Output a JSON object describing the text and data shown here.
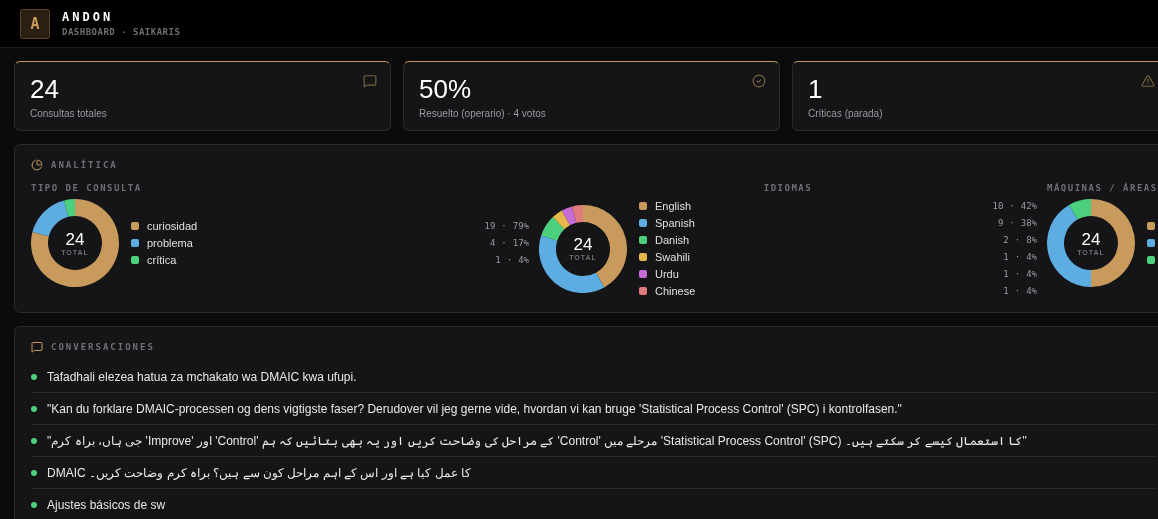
{
  "header": {
    "logo": "A",
    "title": "ANDON",
    "subtitle": "DASHBOARD · SAIKARIS"
  },
  "stats": [
    {
      "kind": "messages",
      "value": "24",
      "label": "Consultas totales"
    },
    {
      "kind": "resolved",
      "value": "50%",
      "label": "Resuelto (operario) · 4 votos"
    },
    {
      "kind": "alert",
      "value": "1",
      "label": "Críticas (parada)"
    }
  ],
  "analytics": {
    "title": "ANALÍTICA",
    "sections": [
      {
        "title": "TIPO DE CONSULTA",
        "kind": "legend",
        "total": "24",
        "total_label": "TOTAL",
        "chart_data": {
          "type": "donut",
          "values": [
            79,
            17,
            4
          ]
        },
        "items": [
          {
            "label": "curiosidad",
            "color": "#c89b5c",
            "count": "19",
            "separator": "·",
            "percent": "79%"
          },
          {
            "label": "problema",
            "color": "#5dade2",
            "count": "4",
            "separator": "·",
            "percent": "17%"
          },
          {
            "label": "crítica",
            "color": "#4cd07d",
            "count": "1",
            "separator": "·",
            "percent": "4%"
          }
        ]
      },
      {
        "title": "IDIOMAS",
        "kind": "legend",
        "total": "24",
        "total_label": "TOTAL",
        "chart_data": {
          "type": "donut",
          "values": [
            42,
            38,
            8,
            4,
            4,
            4
          ]
        },
        "items": [
          {
            "label": "English",
            "color": "#c89b5c",
            "count": "10",
            "separator": "·",
            "percent": "42%"
          },
          {
            "label": "Spanish",
            "color": "#5dade2",
            "count": "9",
            "separator": "·",
            "percent": "38%"
          },
          {
            "label": "Danish",
            "color": "#4cd07d",
            "count": "2",
            "separator": "·",
            "percent": "8%"
          },
          {
            "label": "Swahili",
            "color": "#e6b84a",
            "count": "1",
            "separator": "·",
            "percent": "4%"
          },
          {
            "label": "Urdu",
            "color": "#c86dd7",
            "count": "1",
            "separator": "·",
            "percent": "4%"
          },
          {
            "label": "Chinese",
            "color": "#e07b7b",
            "count": "1",
            "separator": "·",
            "percent": "4%"
          }
        ]
      },
      {
        "title": "MÁQUINAS / ÁREAS",
        "kind": "cut",
        "total": "24",
        "total_label": "TOTAL",
        "items": [
          {
            "color": "#c89b5c"
          },
          {
            "color": "#5dade2"
          },
          {
            "color": "#4cd07d"
          }
        ]
      }
    ]
  },
  "conversations": {
    "title": "CONVERSACIONES",
    "items": [
      {
        "text": "Tafadhali elezea hatua za mchakato wa DMAIC kwa ufupi.",
        "color": "#4cd07d"
      },
      {
        "text": "\"Kan du forklare DMAIC-processen og dens vigtigste faser? Derudover vil jeg gerne vide, hvordan vi kan bruge 'Statistical Process Control' (SPC) i kontrolfasen.\"",
        "color": "#4cd07d"
      },
      {
        "text": "\"جی ہاں، براہ کرم 'Improve' اور 'Control' کے مراحل کی وضاحت کریں اور یہ بھی بتائیں کہ ہم 'Control' مرحلے میں 'Statistical Process Control' (SPC) کا استعمال کیسے کر سکتے ہیں۔\"",
        "color": "#4cd07d"
      },
      {
        "text": "DMAIC کا عمل کیا ہے اور اس کے اہم مراحل کون سے ہیں؟ براہ کرم وضاحت کریں۔",
        "color": "#4cd07d"
      },
      {
        "text": "Ajustes básicos de sw",
        "color": "#4cd07d"
      }
    ]
  }
}
